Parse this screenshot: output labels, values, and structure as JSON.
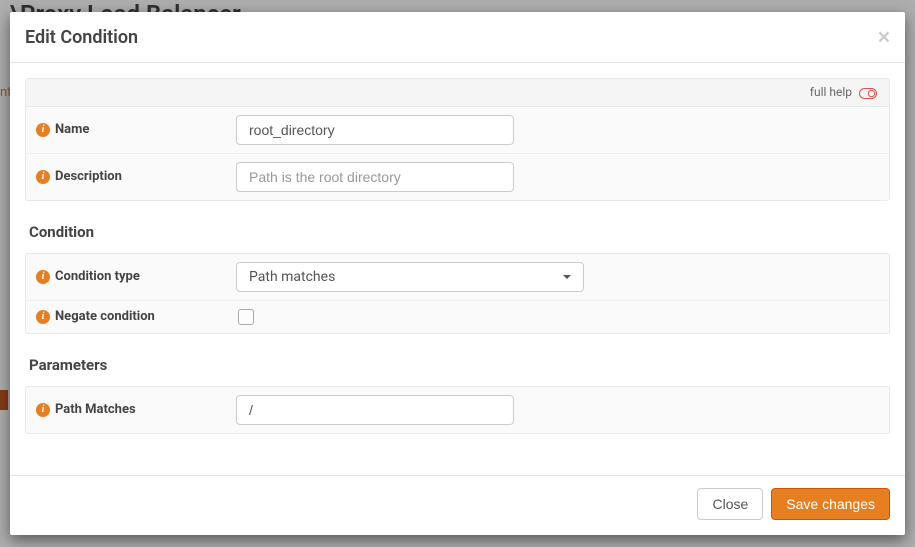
{
  "background": {
    "page_title": "\\Proxy Load Balancer",
    "tab_fragment": "nt"
  },
  "modal": {
    "title": "Edit Condition",
    "help_label": "full help",
    "fields": {
      "name": {
        "label": "Name",
        "value": "root_directory"
      },
      "description": {
        "label": "Description",
        "placeholder": "Path is the root directory",
        "value": ""
      }
    },
    "sections": {
      "condition": {
        "title": "Condition",
        "fields": {
          "condition_type": {
            "label": "Condition type",
            "value": "Path matches"
          },
          "negate": {
            "label": "Negate condition",
            "checked": false
          }
        }
      },
      "parameters": {
        "title": "Parameters",
        "fields": {
          "path_matches": {
            "label": "Path Matches",
            "value": "/"
          }
        }
      }
    },
    "footer": {
      "close": "Close",
      "save": "Save changes"
    }
  }
}
